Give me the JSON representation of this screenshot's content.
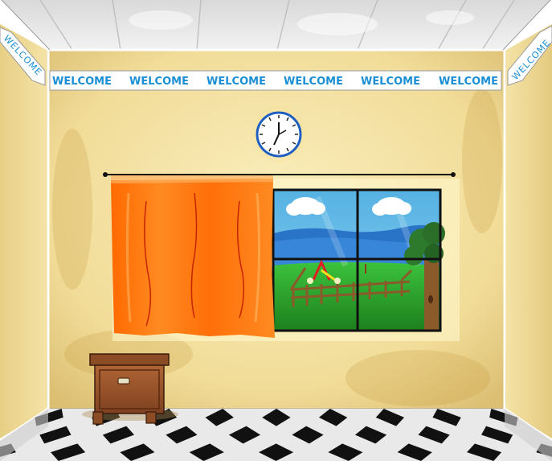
{
  "scene": {
    "banner_words": [
      "WELCOME",
      "WELCOME",
      "WELCOME",
      "WELCOME",
      "WELCOME",
      "WELCOME"
    ],
    "left_wall_banner": "WELCOME",
    "right_wall_banner": "WELCOME",
    "colors": {
      "wall": "#f4e3a4",
      "banner_text": "#1a8fd6",
      "curtain": "#ff7a12",
      "sky": "#5ab8e6",
      "grass": "#2fae2f",
      "nightstand": "#a0582f"
    },
    "icons": [
      "wall-clock-icon",
      "curtain",
      "window",
      "nightstand",
      "tree",
      "fence",
      "clouds"
    ]
  }
}
